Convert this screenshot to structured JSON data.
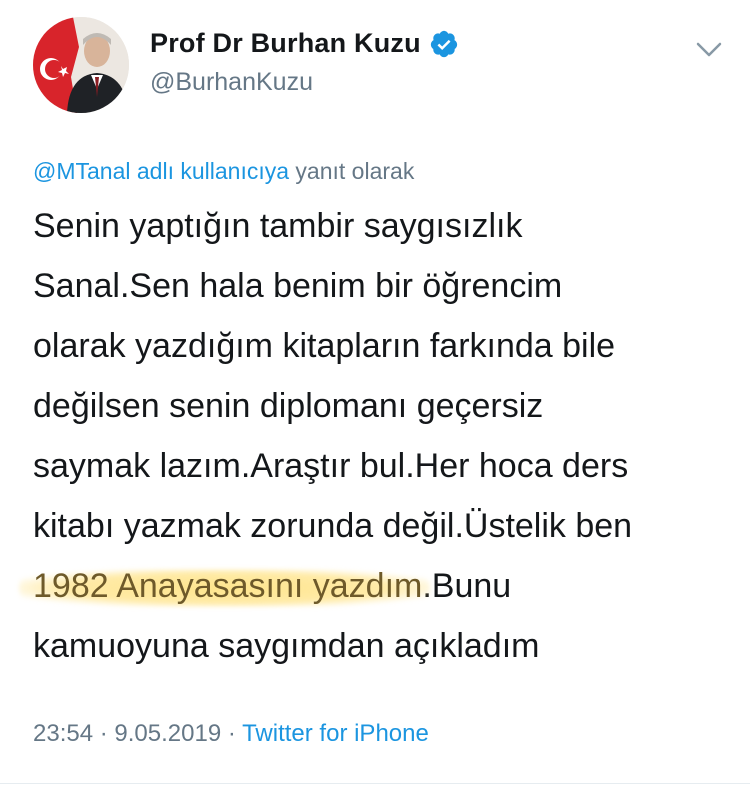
{
  "author": {
    "display_name": "Prof Dr Burhan Kuzu",
    "handle": "@BurhanKuzu",
    "verified": true
  },
  "reply_context": {
    "mention": "@MTanal adlı kullanıcıya",
    "suffix": " yanıt olarak"
  },
  "tweet": {
    "lines": [
      "Senin yaptığın tambir saygısızlık",
      "Sanal.Sen hala benim bir öğrencim",
      "olarak yazdığım kitapların farkında bile",
      "değilsen senin diplomanı geçersiz",
      "saymak lazım.Araştır bul.Her hoca ders",
      "kitabı yazmak zorunda değil.Üstelik ben"
    ],
    "highlighted": "1982 Anayasasını yazdım",
    "after_highlight": ".Bunu",
    "last_line": "kamuoyuna saygımdan açıkladım"
  },
  "meta": {
    "time": "23:54",
    "sep1": " · ",
    "date": "9.05.2019",
    "sep2": " · ",
    "source": "Twitter for iPhone"
  },
  "colors": {
    "link": "#1b95e0",
    "muted": "#657786",
    "text": "#14171a",
    "highlight": "#ffe178"
  },
  "icons": {
    "verified": "verified-badge-icon",
    "menu": "chevron-down-icon"
  }
}
